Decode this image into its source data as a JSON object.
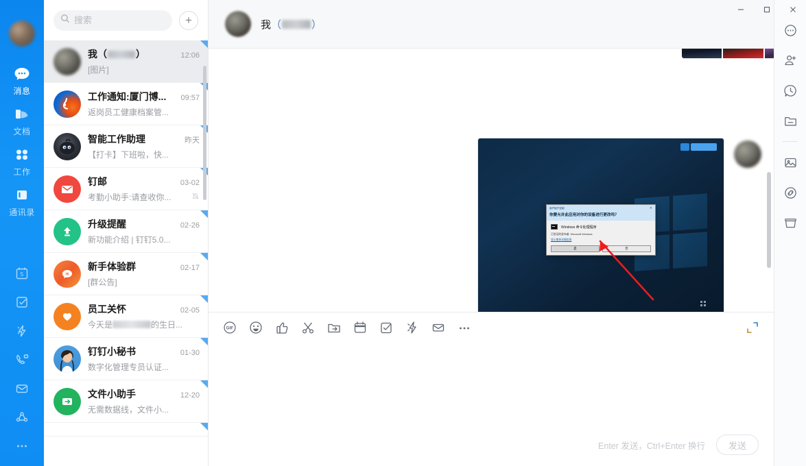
{
  "window": {
    "minimize_label": "—",
    "maximize_label": "□",
    "close_label": "✕"
  },
  "rail": {
    "avatar_name": "user-avatar",
    "nav": [
      {
        "id": "messages",
        "label": "消息",
        "icon": "chat-bubble-icon",
        "active": true
      },
      {
        "id": "docs",
        "label": "文档",
        "icon": "document-folder-icon",
        "active": false
      },
      {
        "id": "work",
        "label": "工作",
        "icon": "grid-clover-icon",
        "active": false
      },
      {
        "id": "contacts",
        "label": "通讯录",
        "icon": "contacts-book-icon",
        "active": false
      }
    ],
    "mini": [
      {
        "id": "calendar",
        "icon": "calendar-5-icon"
      },
      {
        "id": "tasks",
        "icon": "checkbox-task-icon"
      },
      {
        "id": "flash",
        "icon": "lightning-icon"
      },
      {
        "id": "videocall",
        "icon": "video-call-icon"
      },
      {
        "id": "mail",
        "icon": "envelope-icon"
      },
      {
        "id": "team",
        "icon": "team-share-icon"
      },
      {
        "id": "more",
        "icon": "more-dots-icon"
      }
    ]
  },
  "search": {
    "placeholder": "搜索",
    "value": "",
    "icon": "search-icon",
    "add_label": "+"
  },
  "chats": [
    {
      "name": "我（",
      "name_suffix": "）",
      "blurred_name": true,
      "time": "12:06",
      "preview": "[图片]",
      "selected": true,
      "avatar": "photo-blur",
      "muted": false
    },
    {
      "name": "工作通知:厦门博...",
      "time": "09:57",
      "preview": "返岗员工健康档案管...",
      "selected": false,
      "avatar": "dingtalk-blue-orange",
      "muted": false
    },
    {
      "name": "智能工作助理",
      "time": "昨天",
      "preview": "【打卡】下班啦，快...",
      "selected": false,
      "avatar": "dark-bird",
      "muted": false
    },
    {
      "name": "钉邮",
      "time": "03-02",
      "preview": "考勤小助手:请查收你...",
      "selected": false,
      "avatar": "red-envelope",
      "muted": true
    },
    {
      "name": "升级提醒",
      "time": "02-26",
      "preview": "新功能介绍 | 钉钉5.0...",
      "selected": false,
      "avatar": "green-uparrow",
      "muted": false
    },
    {
      "name": "新手体验群",
      "time": "02-17",
      "preview": "[群公告]",
      "selected": false,
      "avatar": "orange-hi-bubble",
      "muted": false
    },
    {
      "name": "员工关怀",
      "time": "02-05",
      "preview_prefix": "今天是",
      "preview_blur": true,
      "preview_suffix": "的生日...",
      "selected": false,
      "avatar": "orange-heart",
      "muted": false
    },
    {
      "name": "钉钉小秘书",
      "time": "01-30",
      "preview": "数字化管理专员认证...",
      "selected": false,
      "avatar": "woman-photo",
      "muted": false
    },
    {
      "name": "文件小助手",
      "time": "12-20",
      "preview": "无需数据线，文件小...",
      "selected": false,
      "avatar": "green-fileshare",
      "muted": false
    }
  ],
  "chat_header": {
    "title_prefix": "我",
    "title_open": "（",
    "title_close": "）",
    "blurred": true,
    "avatar_name": "conversation-avatar"
  },
  "message": {
    "type": "image",
    "avatar_name": "sender-avatar",
    "image_caption": "windows-uac-screenshot",
    "uac": {
      "titlebar": "用户帐户控制",
      "question": "你要允许此应用对你的设备进行更改吗？",
      "app_name": "Windows 命令处理程序",
      "publisher": "已验证的发布者: Microsoft Windows",
      "details_link": "显示更多详细信息",
      "yes_label": "是",
      "no_label": "否",
      "close_label": "✕"
    },
    "tray_badge": "screen-record-badge",
    "annotation": "red-arrow-pointing-to-yes"
  },
  "composer": {
    "tools": [
      {
        "id": "gif",
        "icon": "gif-icon"
      },
      {
        "id": "emoji",
        "icon": "emoji-smile-icon"
      },
      {
        "id": "thumbsup",
        "icon": "thumbs-up-icon"
      },
      {
        "id": "screenshot",
        "icon": "scissors-icon"
      },
      {
        "id": "file",
        "icon": "folder-send-icon"
      },
      {
        "id": "calendar",
        "icon": "calendar-icon"
      },
      {
        "id": "task",
        "icon": "checkbox-task-icon"
      },
      {
        "id": "ding",
        "icon": "lightning-icon"
      },
      {
        "id": "mail",
        "icon": "envelope-icon"
      },
      {
        "id": "more",
        "icon": "more-dots-icon"
      }
    ],
    "expand_icon": "expand-fullscreen-icon",
    "input_value": "",
    "input_placeholder": "",
    "hint": "Enter 发送，Ctrl+Enter 换行",
    "send_label": "发送"
  },
  "right_rail": [
    {
      "id": "more",
      "icon": "more-circle-icon"
    },
    {
      "id": "add-member",
      "icon": "add-person-icon"
    },
    {
      "id": "history",
      "icon": "history-clock-icon"
    },
    {
      "id": "files",
      "icon": "folder-icon"
    },
    {
      "id": "divider",
      "icon": "divider"
    },
    {
      "id": "images",
      "icon": "image-picture-icon"
    },
    {
      "id": "links",
      "icon": "link-chain-icon"
    },
    {
      "id": "archive",
      "icon": "archive-box-icon"
    }
  ],
  "colors": {
    "brand_blue": "#1296f7",
    "selected_item": "#eaecef",
    "corner_marker": "#5aa9ef",
    "mail_red": "#f0483e",
    "upgrade_green": "#23c287",
    "care_orange": "#f58220",
    "file_green": "#22b35e"
  }
}
